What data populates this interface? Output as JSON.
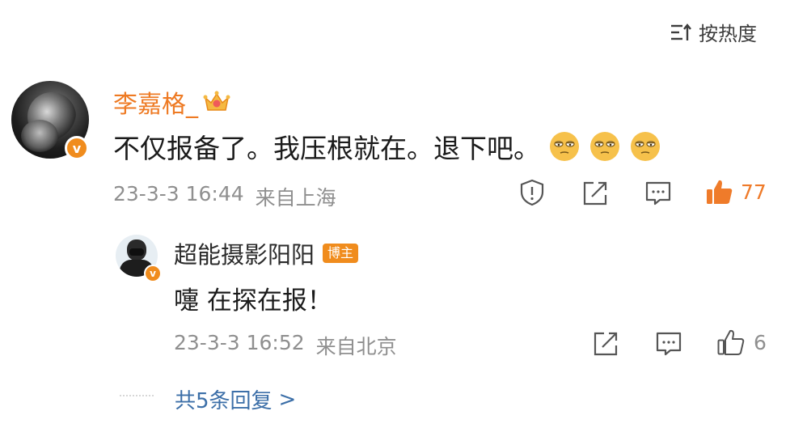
{
  "sort": {
    "label": "按热度",
    "icon": "sort-icon"
  },
  "comment": {
    "username": "李嘉格_",
    "crown_icon": "crown-icon",
    "verified_icon": "verified-v-icon",
    "verified_text": "v",
    "text": "不仅报备了。我压根就在。退下吧。",
    "emojis": [
      "sleepy-face-emoji",
      "sleepy-face-emoji",
      "sleepy-face-emoji"
    ],
    "date": "23-3-3 16:44",
    "location": "来自上海",
    "actions": {
      "report_icon": "report-shield-icon",
      "share_icon": "share-icon",
      "comment_icon": "comment-icon",
      "like_icon": "thumbs-up-filled-icon",
      "like_count": "77"
    }
  },
  "reply": {
    "username": "超能摄影阳阳",
    "badge": "博主",
    "verified_text": "v",
    "text": "嚏 在探在报！",
    "date": "23-3-3 16:52",
    "location": "来自北京",
    "actions": {
      "share_icon": "share-icon",
      "comment_icon": "comment-icon",
      "like_icon": "thumbs-up-icon",
      "like_count": "6"
    }
  },
  "more_replies": {
    "label": "共5条回复",
    "chevron": ">"
  },
  "colors": {
    "accent_orange": "#ee7a23",
    "link_blue": "#3c6fa8",
    "meta_gray": "#8f8f8f",
    "text_dark": "#1b1b1b",
    "emoji_yellow": "#f6c14b"
  }
}
